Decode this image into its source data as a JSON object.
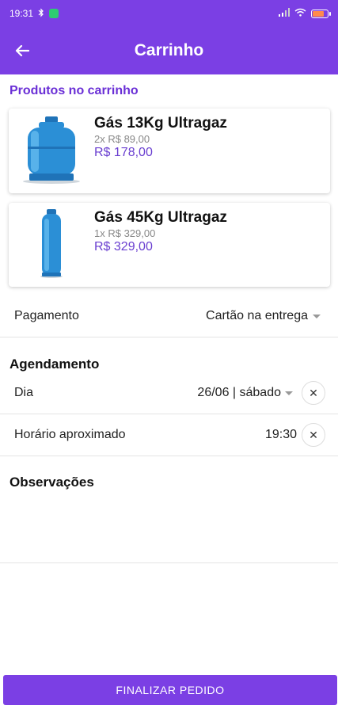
{
  "statusbar": {
    "time": "19:31"
  },
  "appbar": {
    "title": "Carrinho"
  },
  "products_section_title": "Produtos no carrinho",
  "products": [
    {
      "name": "Gás 13Kg Ultragaz",
      "qty_price": "2x R$ 89,00",
      "total": "R$ 178,00",
      "image": "gas-cylinder-13kg"
    },
    {
      "name": "Gás 45Kg Ultragaz",
      "qty_price": "1x R$ 329,00",
      "total": "R$ 329,00",
      "image": "gas-cylinder-45kg"
    }
  ],
  "payment": {
    "label": "Pagamento",
    "value": "Cartão na entrega"
  },
  "schedule": {
    "heading": "Agendamento",
    "day": {
      "label": "Dia",
      "value": "26/06 | sábado"
    },
    "time": {
      "label": "Horário aproximado",
      "value": "19:30"
    }
  },
  "notes": {
    "heading": "Observações"
  },
  "cta": {
    "label": "FINALIZAR PEDIDO"
  },
  "colors": {
    "primary": "#7b3fe4",
    "price": "#6a3fd0",
    "cylinder": "#2b8fd6"
  }
}
